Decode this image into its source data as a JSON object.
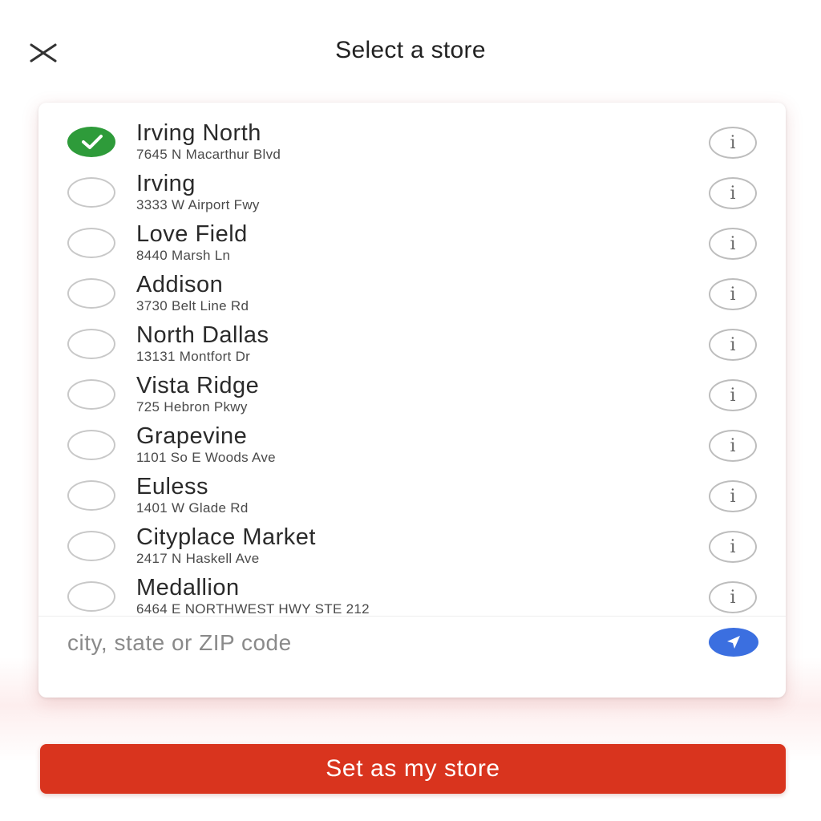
{
  "header": {
    "title": "Select a store",
    "close_icon": "close-icon"
  },
  "stores": [
    {
      "name": "Irving North",
      "address": "7645 N Macarthur Blvd",
      "selected": true
    },
    {
      "name": "Irving",
      "address": "3333 W Airport Fwy",
      "selected": false
    },
    {
      "name": "Love Field",
      "address": "8440 Marsh Ln",
      "selected": false
    },
    {
      "name": "Addison",
      "address": "3730 Belt Line Rd",
      "selected": false
    },
    {
      "name": "North Dallas",
      "address": "13131 Montfort Dr",
      "selected": false
    },
    {
      "name": "Vista Ridge",
      "address": "725 Hebron Pkwy",
      "selected": false
    },
    {
      "name": "Grapevine",
      "address": "1101 So E Woods Ave",
      "selected": false
    },
    {
      "name": "Euless",
      "address": "1401 W Glade Rd",
      "selected": false
    },
    {
      "name": "Cityplace Market",
      "address": "2417 N Haskell Ave",
      "selected": false
    },
    {
      "name": "Medallion",
      "address": "6464 E NORTHWEST HWY STE 212",
      "selected": false
    }
  ],
  "search": {
    "placeholder": "city, state or ZIP code",
    "value": ""
  },
  "info_glyph": "i",
  "cta": {
    "label": "Set as my store"
  },
  "colors": {
    "selected": "#2e9b3a",
    "locate": "#3b6fe0",
    "cta": "#d9341e"
  }
}
